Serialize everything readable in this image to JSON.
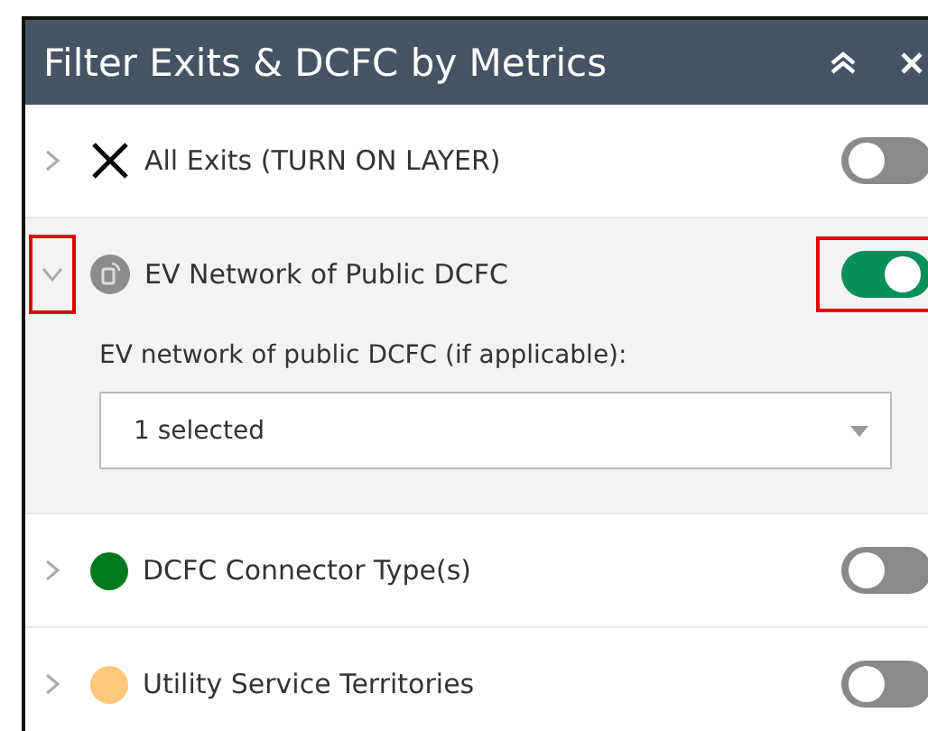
{
  "panel": {
    "title": "Filter Exits & DCFC by Metrics",
    "controls": [
      {
        "kind": "collapse"
      },
      {
        "kind": "close"
      }
    ]
  },
  "layers": [
    {
      "label": "All Exits (TURN ON LAYER)",
      "kind": "cross",
      "expanded": false,
      "on": false,
      "highlighted": false
    },
    {
      "label": "EV Network of Public DCFC",
      "kind": "network",
      "expanded": true,
      "on": true,
      "highlighted": true,
      "filter": {
        "label": "EV network of public DCFC (if applicable):",
        "value": "1 selected"
      }
    },
    {
      "label": "DCFC Connector Type(s)",
      "kind": "dot",
      "color": "#007a1c",
      "expanded": false,
      "on": false,
      "highlighted": false
    },
    {
      "label": "Utility Service Territories",
      "kind": "dot",
      "color": "#ffc87a",
      "expanded": false,
      "on": false,
      "highlighted": false
    }
  ]
}
